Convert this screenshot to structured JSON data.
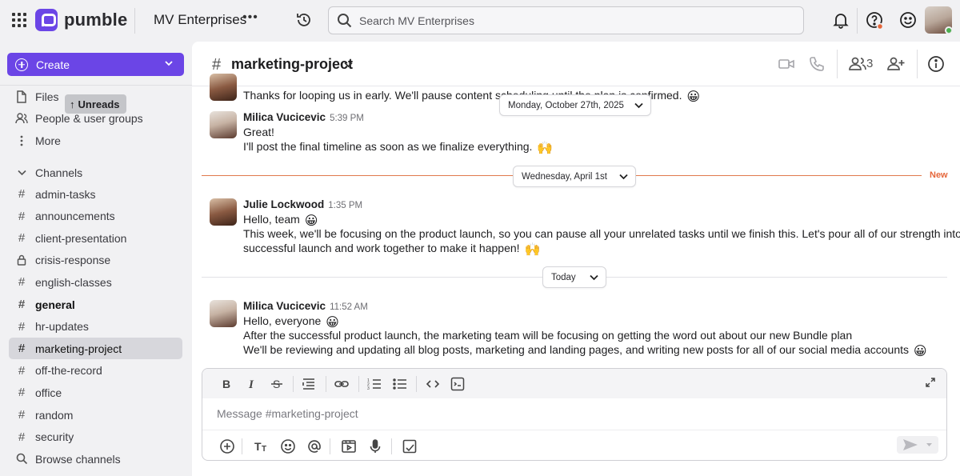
{
  "app": {
    "name": "pumble",
    "workspace": "MV Enterprises",
    "brand_color": "#6b45e6"
  },
  "topbar": {
    "search_placeholder": "Search MV Enterprises",
    "icons": [
      "apps-grid-icon",
      "history-icon",
      "search-icon",
      "bell-icon",
      "help-icon",
      "emoji-status-icon",
      "user-avatar"
    ]
  },
  "sidebar": {
    "create_label": "Create",
    "unreads_label": "Unreads",
    "nav": [
      {
        "label": "Files",
        "icon": "file-icon"
      },
      {
        "label": "People & user groups",
        "icon": "people-icon"
      },
      {
        "label": "More",
        "icon": "more-vertical-icon"
      }
    ],
    "channels_header": "Channels",
    "channels": [
      {
        "label": "admin-tasks",
        "icon": "hash",
        "bold": false,
        "active": false
      },
      {
        "label": "announcements",
        "icon": "hash",
        "bold": false,
        "active": false
      },
      {
        "label": "client-presentation",
        "icon": "hash",
        "bold": false,
        "active": false
      },
      {
        "label": "crisis-response",
        "icon": "lock",
        "bold": false,
        "active": false
      },
      {
        "label": "english-classes",
        "icon": "hash",
        "bold": false,
        "active": false
      },
      {
        "label": "general",
        "icon": "hash",
        "bold": true,
        "active": false
      },
      {
        "label": "hr-updates",
        "icon": "hash",
        "bold": false,
        "active": false
      },
      {
        "label": "marketing-project",
        "icon": "hash",
        "bold": false,
        "active": true
      },
      {
        "label": "off-the-record",
        "icon": "hash",
        "bold": false,
        "active": false
      },
      {
        "label": "office",
        "icon": "hash",
        "bold": false,
        "active": false
      },
      {
        "label": "random",
        "icon": "hash",
        "bold": false,
        "active": false
      },
      {
        "label": "security",
        "icon": "hash",
        "bold": false,
        "active": false
      }
    ],
    "browse_label": "Browse channels"
  },
  "channel": {
    "hash": "#",
    "name": "marketing-project",
    "member_count": "3"
  },
  "messages": {
    "partial": {
      "text": "Thanks for looping us in early. We'll pause content scheduling until the plan is confirmed.",
      "emoji": "😀"
    },
    "m1": {
      "author": "Milica Vucicevic",
      "time": "5:39 PM",
      "line1": "Great!",
      "line2": "I'll post the final timeline as soon as we finalize everything.",
      "emoji2": "🙌"
    },
    "m2": {
      "author": "Julie Lockwood",
      "time": "1:35 PM",
      "line1": "Hello, team",
      "emoji1": "😀",
      "line2": "This week, we'll be focusing on the product launch, so you can pause all your unrelated tasks until we finish this. Let's pour all of our strength into a",
      "line3": "successful launch and work together to make it happen!",
      "emoji3": "🙌"
    },
    "m3": {
      "author": "Milica Vucicevic",
      "time": "11:52 AM",
      "line1": "Hello, everyone",
      "emoji1": "😀",
      "line2": "After the successful product launch, the marketing team will be focusing on getting the word out about our new Bundle plan",
      "line3": "We'll be reviewing and updating all blog posts, marketing and landing pages, and writing new posts for all of our social media accounts",
      "emoji3": "😀"
    }
  },
  "dates": {
    "floating": "Monday, October 27th, 2025",
    "sep1": "Wednesday, April 1st",
    "new_label": "New",
    "sep2": "Today"
  },
  "composer": {
    "placeholder": "Message #marketing-project"
  }
}
